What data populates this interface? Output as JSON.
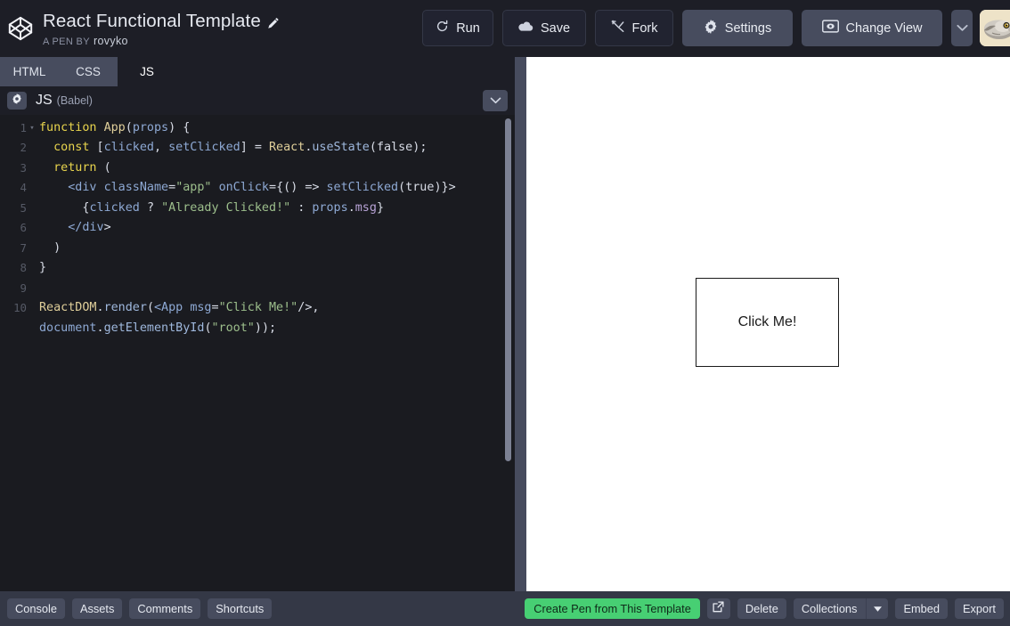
{
  "header": {
    "logo_icon": "codepen-logo-icon",
    "pen_title": "React Functional Template",
    "edit_icon": "pencil-icon",
    "by_label": "A PEN BY",
    "by_user": "rovyko",
    "avatar_icon": "pufferfish-avatar"
  },
  "toolbar": {
    "run_label": "Run",
    "run_icon": "refresh-icon",
    "save_label": "Save",
    "save_icon": "cloud-icon",
    "fork_label": "Fork",
    "fork_icon": "fork-icon",
    "settings_label": "Settings",
    "settings_icon": "gear-icon",
    "changeview_label": "Change View",
    "changeview_icon": "layout-eye-icon",
    "caret_icon": "chevron-down-icon"
  },
  "editor": {
    "tabs": [
      {
        "label": "HTML",
        "active": false
      },
      {
        "label": "CSS",
        "active": false
      },
      {
        "label": "JS",
        "active": true
      }
    ],
    "gear_icon": "gear-icon",
    "panel_title": "JS",
    "panel_subtitle": "(Babel)",
    "collapse_icon": "chevron-down-icon",
    "scrollbar": "vertical-scrollbar",
    "code_lines": [
      {
        "num": "1",
        "fold": "▾",
        "text": "function App(props) {"
      },
      {
        "num": "2",
        "fold": "",
        "text": "  const [clicked, setClicked] = React.useState(false);"
      },
      {
        "num": "3",
        "fold": "",
        "text": "  return ("
      },
      {
        "num": "4",
        "fold": "",
        "text": "    <div className=\"app\" onClick={() => setClicked(true)}>"
      },
      {
        "num": "5",
        "fold": "",
        "text": "      {clicked ? \"Already Clicked!\" : props.msg}"
      },
      {
        "num": "6",
        "fold": "",
        "text": "    </div>"
      },
      {
        "num": "7",
        "fold": "",
        "text": "  )"
      },
      {
        "num": "8",
        "fold": "",
        "text": "}"
      },
      {
        "num": "9",
        "fold": "",
        "text": ""
      },
      {
        "num": "10",
        "fold": "",
        "text": "ReactDOM.render(<App msg=\"Click Me!\"/>, document.getElementById(\"root\"));"
      }
    ]
  },
  "preview": {
    "app_text": "Click Me!"
  },
  "bottombar": {
    "left_buttons": [
      {
        "label": "Console"
      },
      {
        "label": "Assets"
      },
      {
        "label": "Comments"
      },
      {
        "label": "Shortcuts"
      }
    ],
    "create_pen_label": "Create Pen from This Template",
    "open_external_icon": "external-link-icon",
    "delete_label": "Delete",
    "collections_label": "Collections",
    "collections_caret_icon": "caret-down-icon",
    "embed_label": "Embed",
    "export_label": "Export"
  },
  "colors": {
    "accent_green": "#47cf73",
    "chrome_dark": "#1d1e26",
    "code_bg": "#1a1b20",
    "chrome_grey": "#474c5e",
    "bottombar_bg": "#343846"
  }
}
